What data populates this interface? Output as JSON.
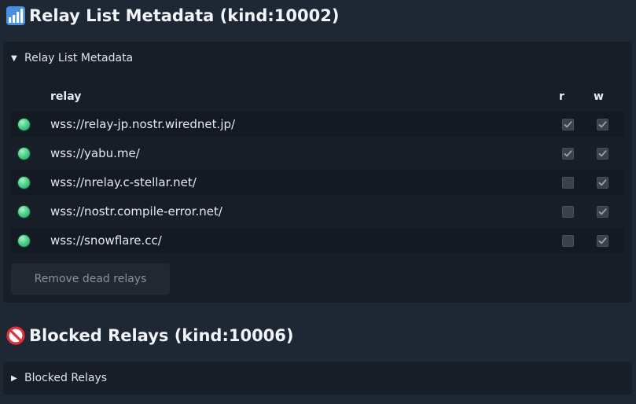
{
  "section1": {
    "title": "Relay List Metadata (kind:10002)",
    "icon": "bar-chart-icon",
    "summary": "Relay List Metadata",
    "table_header": {
      "relay": "relay",
      "read": "r",
      "write": "w"
    },
    "relays": [
      {
        "url": "wss://relay-jp.nostr.wirednet.jp/",
        "status": "online",
        "read": true,
        "write": true
      },
      {
        "url": "wss://yabu.me/",
        "status": "online",
        "read": true,
        "write": true
      },
      {
        "url": "wss://nrelay.c-stellar.net/",
        "status": "online",
        "read": false,
        "write": true
      },
      {
        "url": "wss://nostr.compile-error.net/",
        "status": "online",
        "read": false,
        "write": true
      },
      {
        "url": "wss://snowflare.cc/",
        "status": "online",
        "read": false,
        "write": true
      }
    ],
    "remove_button": "Remove dead relays"
  },
  "section2": {
    "title": "Blocked Relays (kind:10006)",
    "icon": "prohibited-icon",
    "summary": "Blocked Relays"
  },
  "colors": {
    "page_bg": "#1e2734",
    "panel_bg": "#171e28",
    "status_online": "#4fd38a",
    "checkbox_bg": "#3b414a"
  }
}
